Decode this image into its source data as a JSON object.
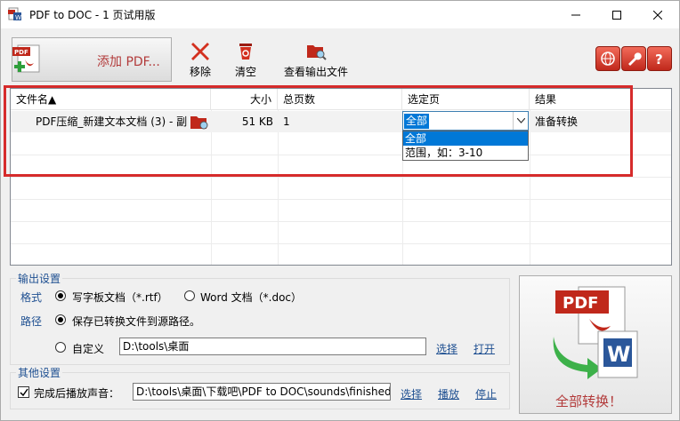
{
  "window": {
    "title": "PDF to DOC - 1 页试用版"
  },
  "toolbar": {
    "add_pdf_label": "添加 PDF...",
    "remove_label": "移除",
    "clear_label": "清空",
    "view_output_label": "查看输出文件"
  },
  "list": {
    "headers": {
      "name": "文件名▲",
      "size": "大小",
      "pages": "总页数",
      "select": "选定页",
      "result": "结果"
    },
    "rows": [
      {
        "name": "PDF压缩_新建文本文档 (3) - 副",
        "size": "51 KB",
        "pages": "1",
        "select": "全部",
        "result": "准备转换"
      }
    ],
    "dropdown_options": [
      "全部",
      "范围，如：3-10"
    ]
  },
  "output_settings": {
    "legend": "输出设置",
    "format_label": "格式",
    "format_rtf": "写字板文档（*.rtf）",
    "format_doc": "Word 文档（*.doc）",
    "path_label": "路径",
    "save_to_source": "保存已转换文件到源路径。",
    "custom_label": "自定义",
    "custom_path": "D:\\tools\\桌面",
    "choose": "选择",
    "open": "打开"
  },
  "other_settings": {
    "legend": "其他设置",
    "play_sound_label": "完成后播放声音：",
    "sound_path": "D:\\tools\\桌面\\下载吧\\PDF to DOC\\sounds\\finished.w",
    "choose": "选择",
    "play": "播放",
    "stop": "停止"
  },
  "convert": {
    "label": "全部转换！",
    "icon_text": "PDF"
  },
  "colors": {
    "accent_red": "#b23a3a",
    "link_blue": "#1e4f91",
    "highlight": "#d62b2b",
    "selection": "#0078d7"
  },
  "icons": [
    "pdf-doc-icon",
    "add-pdf-icon",
    "remove-x-icon",
    "recycle-bin-icon",
    "folder-search-icon",
    "globe-icon",
    "wrench-icon",
    "question-icon",
    "pdf-to-word-icon"
  ]
}
